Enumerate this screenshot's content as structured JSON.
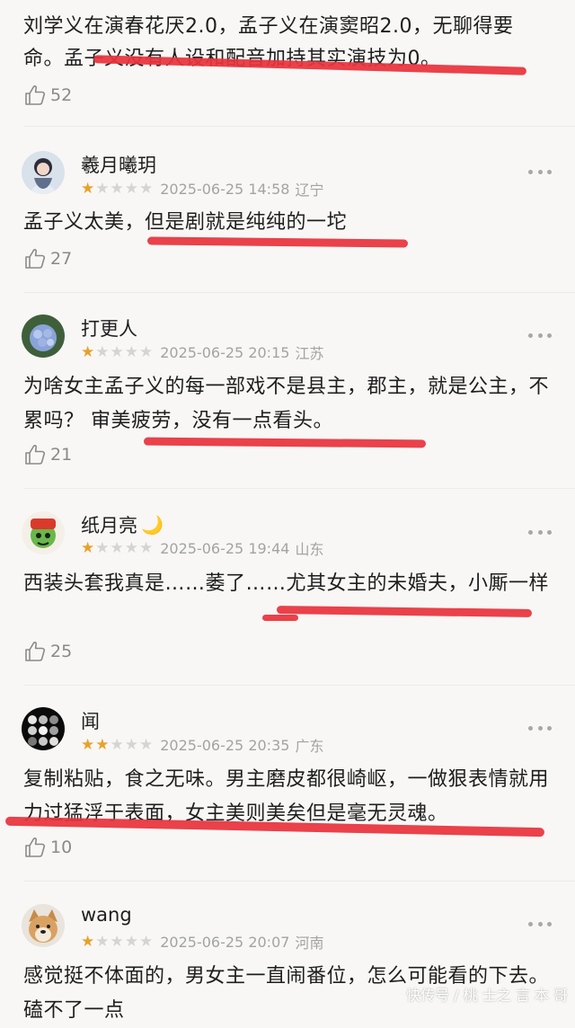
{
  "top_comment": {
    "text": "刘学义在演春花厌2.0，孟子义在演窦昭2.0，无聊得要命。孟子义没有人设和配音加持其实演技为0。",
    "likes": "52"
  },
  "comments": [
    {
      "user": "羲月曦玥",
      "rating": 1,
      "date": "2025-06-25 14:58",
      "location": "辽宁",
      "text": "孟子义太美，但是剧就是纯纯的一坨",
      "likes": "27"
    },
    {
      "user": "打更人",
      "rating": 1,
      "date": "2025-06-25 20:15",
      "location": "江苏",
      "text": "为啥女主孟子义的每一部戏不是县主，郡主，就是公主，不累吗？ 审美疲劳，没有一点看头。",
      "likes": "21"
    },
    {
      "user": "纸月亮",
      "rating": 1,
      "date": "2025-06-25 19:44",
      "location": "山东",
      "text": "西装头套我真是……萎了……尤其女主的未婚夫，小厮一样",
      "likes": "25"
    },
    {
      "user": "闻",
      "rating": 2,
      "date": "2025-06-25 20:35",
      "location": "广东",
      "text": "复制粘贴，食之无味。男主磨皮都很崎岖，一做狠表情就用力过猛浮于表面，女主美则美矣但是毫无灵魂。",
      "likes": "10"
    },
    {
      "user": "wang",
      "rating": 1,
      "date": "2025-06-25 20:07",
      "location": "河南",
      "text": "感觉挺不体面的，男女主一直闹番位，怎么可能看的下去。磕不了一点"
    }
  ],
  "moon_emoji": "🌙",
  "watermark": "快传号 / 桃 士之 言 本 哥",
  "colors": {
    "background": "#f8f7f5",
    "star_on": "#e8a12b",
    "star_off": "#d4d4d4",
    "highlight": "#e8333c",
    "meta": "#a3a3a3"
  },
  "icons": [
    "thumbs-up-icon",
    "more-icon",
    "star-icon",
    "moon-emoji"
  ]
}
